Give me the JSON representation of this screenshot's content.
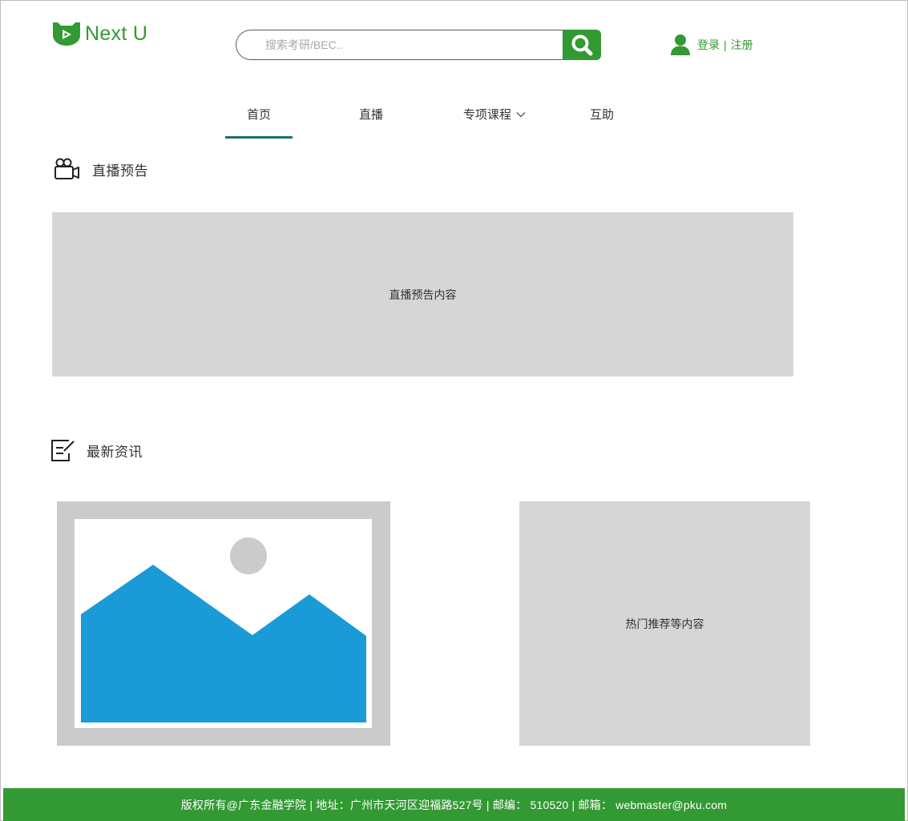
{
  "brand": {
    "name": "Next U",
    "color": "#339933",
    "logo_icon": "play-shield-icon"
  },
  "search": {
    "placeholder": "搜索考研/BEC..",
    "button_icon": "search-icon"
  },
  "account": {
    "login": "登录",
    "separator": "|",
    "register": "注册",
    "icon": "user-icon"
  },
  "nav": {
    "items": [
      {
        "label": "首页",
        "active": true
      },
      {
        "label": "直播",
        "active": false
      },
      {
        "label": "专项课程",
        "active": false,
        "has_dropdown": true
      },
      {
        "label": "互助",
        "active": false
      }
    ],
    "active_color": "#1d6f6a"
  },
  "live": {
    "title": "直播预告",
    "icon": "video-camera-icon",
    "content": "直播预告内容"
  },
  "news": {
    "title": "最新资讯",
    "icon": "edit-note-icon",
    "image_icon": "image-placeholder-icon",
    "side_content": "热门推荐等内容"
  },
  "footer": {
    "text": "版权所有@广东金融学院 | 地址：广州市天河区迎福路527号 | 邮编： 510520 | 邮箱： webmaster@pku.com",
    "bg_color": "#339933"
  }
}
